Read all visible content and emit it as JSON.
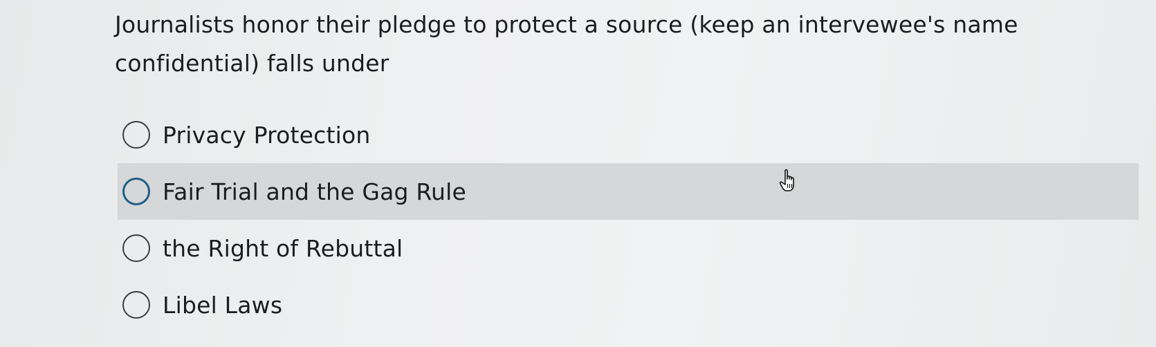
{
  "question": {
    "text": "Journalists honor their pledge to protect a source (keep an intervewee's name confidential) falls under"
  },
  "options": [
    {
      "label": "Privacy Protection",
      "highlighted": false
    },
    {
      "label": "Fair Trial and the Gag Rule",
      "highlighted": true
    },
    {
      "label": "the Right of Rebuttal",
      "highlighted": false
    },
    {
      "label": "Libel Laws",
      "highlighted": false
    }
  ],
  "cursor": {
    "icon": "hand-pointer-icon"
  },
  "colors": {
    "highlight": "#d6d7d8",
    "focus_ring": "#1f5f87"
  }
}
